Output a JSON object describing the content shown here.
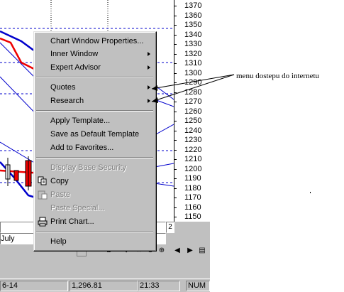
{
  "price_axis": {
    "labels": [
      "1370",
      "1360",
      "1350",
      "1340",
      "1330",
      "1320",
      "1310",
      "1300",
      "1290",
      "1280",
      "1270",
      "1260",
      "1250",
      "1240",
      "1230",
      "1220",
      "1210",
      "1200",
      "1190",
      "1180",
      "1170",
      "1160",
      "1150"
    ]
  },
  "chart": {
    "month_label": "July",
    "scroll_value": "2"
  },
  "context_menu": {
    "items": [
      {
        "label": "Chart Window Properties...",
        "submenu": false,
        "enabled": true
      },
      {
        "label": "Inner Window",
        "submenu": true,
        "enabled": true
      },
      {
        "label": "Expert Advisor",
        "submenu": true,
        "enabled": true
      },
      {
        "label": "Quotes",
        "submenu": true,
        "enabled": true
      },
      {
        "label": "Research",
        "submenu": true,
        "enabled": true
      },
      {
        "label": "Apply Template...",
        "submenu": false,
        "enabled": true
      },
      {
        "label": "Save as Default Template",
        "submenu": false,
        "enabled": true
      },
      {
        "label": "Add to Favorites...",
        "submenu": false,
        "enabled": true
      },
      {
        "label": "Display Base Security",
        "submenu": false,
        "enabled": false
      },
      {
        "label": "Copy",
        "submenu": false,
        "enabled": true,
        "icon": "copy-icon"
      },
      {
        "label": "Paste",
        "submenu": false,
        "enabled": false,
        "icon": "paste-icon"
      },
      {
        "label": "Paste Special...",
        "submenu": false,
        "enabled": false
      },
      {
        "label": "Print Chart...",
        "submenu": false,
        "enabled": true,
        "icon": "printer-icon"
      },
      {
        "label": "Help",
        "submenu": false,
        "enabled": true
      }
    ]
  },
  "annotation": {
    "text": "menu dostepu do internetu"
  },
  "toolbar": {
    "buttons": [
      "D",
      "↕",
      "↔",
      "⊖",
      "⊕",
      "◀",
      "▶",
      "▤"
    ]
  },
  "status_bar": {
    "date": "6-14",
    "price": "1,296.81",
    "time": "21:33",
    "mode": "NUM"
  },
  "colors": {
    "menu_bg": "#c0c0c0",
    "line_blue": "#0000cc",
    "line_red": "#ee0000",
    "grid_dashed": "#0000cc"
  }
}
